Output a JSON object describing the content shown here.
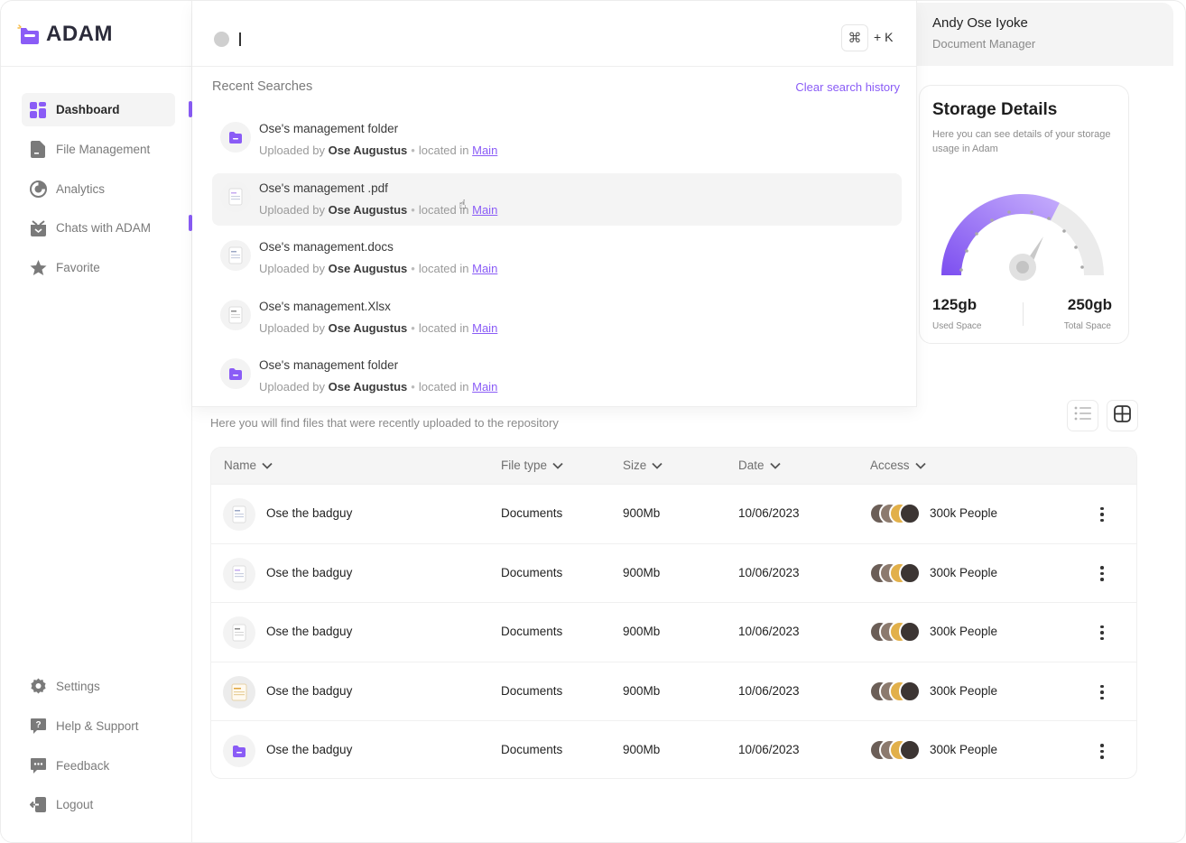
{
  "app": {
    "name": "ADAM",
    "accent": "#8a5cf6"
  },
  "sidebar": {
    "items": [
      {
        "label": "Dashboard",
        "icon": "dashboard-grid-icon",
        "active": true
      },
      {
        "label": "File Management",
        "icon": "file-icon"
      },
      {
        "label": "Analytics",
        "icon": "analytics-icon"
      },
      {
        "label": "Chats with ADAM",
        "icon": "chat-box-icon"
      },
      {
        "label": "Favorite",
        "icon": "star-icon"
      }
    ],
    "bottom": [
      {
        "label": "Settings",
        "icon": "gear-icon"
      },
      {
        "label": "Help & Support",
        "icon": "help-icon"
      },
      {
        "label": "Feedback",
        "icon": "feedback-icon"
      },
      {
        "label": "Logout",
        "icon": "logout-icon"
      }
    ]
  },
  "search": {
    "value": "",
    "shortcut_key": "⌘",
    "shortcut_label": "+ K",
    "recent_title": "Recent Searches",
    "clear_label": "Clear search history",
    "results": [
      {
        "title": "Ose's management folder",
        "uploaded_by_label": "Uploaded by",
        "uploader": "Ose Augustus",
        "location_label": "located in",
        "location": "Main",
        "icon": "folder-icon"
      },
      {
        "title": "Ose's management .pdf",
        "uploaded_by_label": "Uploaded by",
        "uploader": "Ose Augustus",
        "location_label": "located in",
        "location": "Main",
        "icon": "pdf-file-icon"
      },
      {
        "title": "Ose's management.docs",
        "uploaded_by_label": "Uploaded by",
        "uploader": "Ose Augustus",
        "location_label": "located in",
        "location": "Main",
        "icon": "doc-file-icon"
      },
      {
        "title": "Ose's management.Xlsx",
        "uploaded_by_label": "Uploaded by",
        "uploader": "Ose Augustus",
        "location_label": "located in",
        "location": "Main",
        "icon": "xlsx-file-icon"
      },
      {
        "title": "Ose's management folder",
        "uploaded_by_label": "Uploaded by",
        "uploader": "Ose Augustus",
        "location_label": "located in",
        "location": "Main",
        "icon": "folder-icon"
      }
    ]
  },
  "user": {
    "name": "Andy Ose Iyoke",
    "role": "Document Manager"
  },
  "storage": {
    "title": "Storage Details",
    "description": "Here you can see details of your storage usage in Adam",
    "used": "125gb",
    "used_label": "Used Space",
    "total": "250gb",
    "total_label": "Total Space",
    "used_fraction": 0.5
  },
  "files": {
    "subtitle": "Here you will find files that were recently uploaded to the repository",
    "columns": {
      "name": "Name",
      "type": "File type",
      "size": "Size",
      "date": "Date",
      "access": "Access"
    },
    "rows": [
      {
        "name": "Ose the badguy",
        "type": "Documents",
        "size": "900Mb",
        "date": "10/06/2023",
        "access": "300k People",
        "icon": "doc-file-icon"
      },
      {
        "name": "Ose the badguy",
        "type": "Documents",
        "size": "900Mb",
        "date": "10/06/2023",
        "access": "300k People",
        "icon": "pdf-file-icon"
      },
      {
        "name": "Ose the badguy",
        "type": "Documents",
        "size": "900Mb",
        "date": "10/06/2023",
        "access": "300k People",
        "icon": "xlsx-file-icon"
      },
      {
        "name": "Ose the badguy",
        "type": "Documents",
        "size": "900Mb",
        "date": "10/06/2023",
        "access": "300k People",
        "icon": "image-file-icon"
      },
      {
        "name": "Ose the badguy",
        "type": "Documents",
        "size": "900Mb",
        "date": "10/06/2023",
        "access": "300k People",
        "icon": "folder-icon"
      }
    ]
  }
}
